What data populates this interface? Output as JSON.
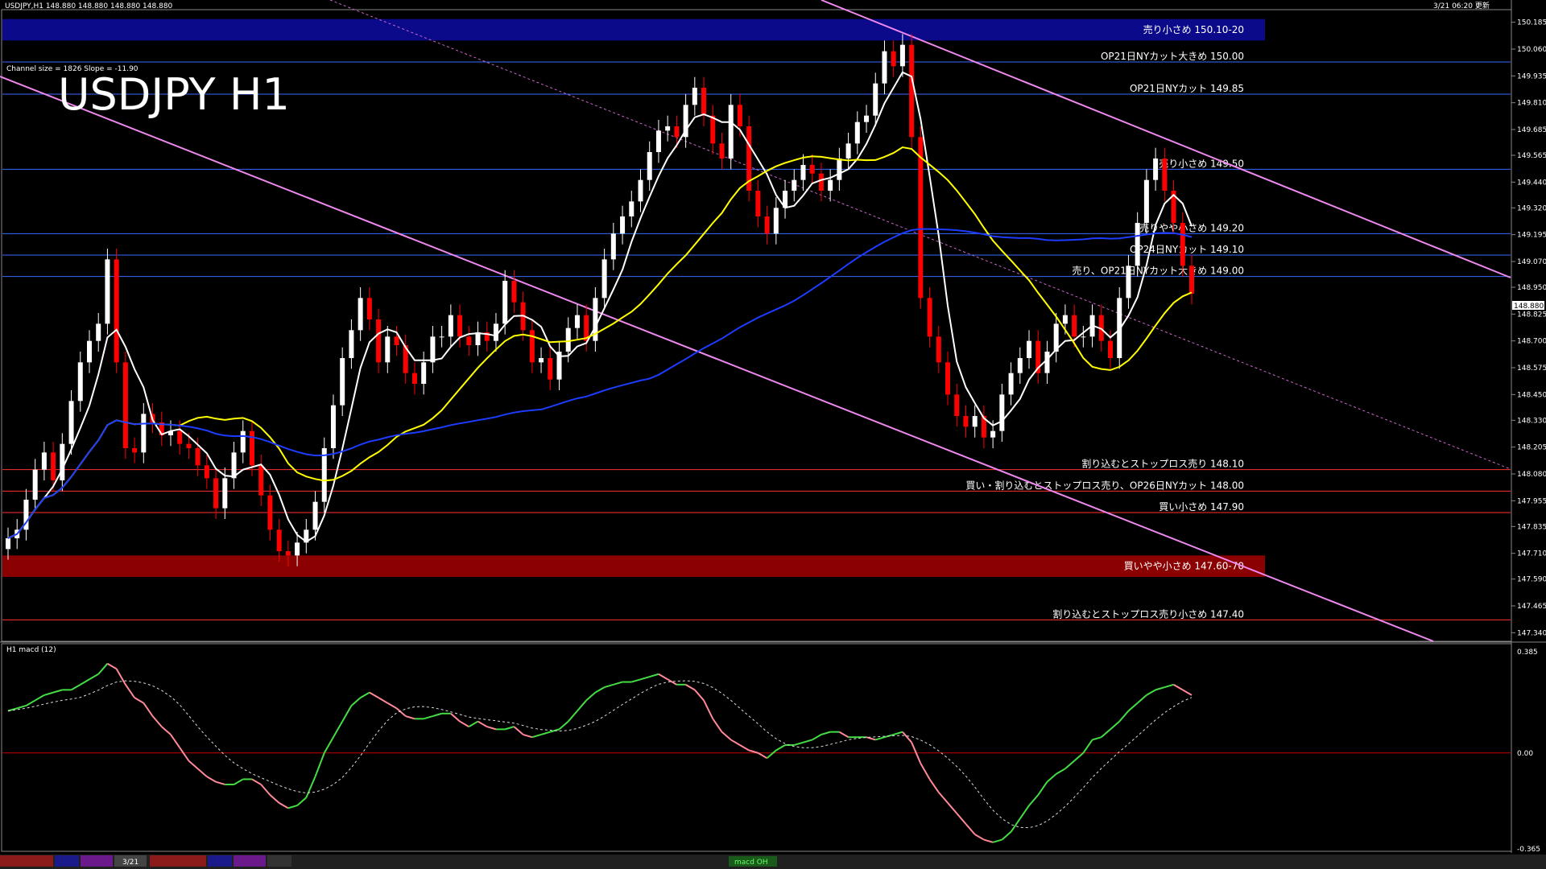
{
  "header": {
    "left": "USDJPY,H1  148.880 148.880 148.880 148.880",
    "right": "3/21 06:20 更新"
  },
  "watermark": "USDJPY H1",
  "channel_info": "Channel size = 1826 Slope = -11.90",
  "subwindow_label": "H1  macd (12)",
  "colors": {
    "bg": "#000000",
    "bull": "#ffffff",
    "bear": "#ff0000",
    "blue_zone": "#0a0a8a",
    "red_zone": "#8b0000",
    "ma_white": "#ffffff",
    "ma_yellow": "#ffff00",
    "ma_blue": "#1e3cff",
    "macd_up": "#44dd44",
    "macd_down": "#ff8899",
    "channel": "#ee88ee"
  },
  "chart_data": {
    "type": "candlestick",
    "symbol": "USDJPY",
    "timeframe": "H1",
    "ylim": [
      147.3,
      150.24
    ],
    "y_ticks": [
      "150.185",
      "150.060",
      "149.935",
      "149.810",
      "149.685",
      "149.565",
      "149.440",
      "149.320",
      "149.195",
      "149.070",
      "148.950",
      "148.825",
      "148.700",
      "148.575",
      "148.450",
      "148.330",
      "148.205",
      "148.080",
      "147.955",
      "147.835",
      "147.710",
      "147.590",
      "147.465",
      "147.340"
    ],
    "current_price": "148.880",
    "zones": [
      {
        "label": "売り小さめ 150.10-20",
        "from": 150.1,
        "to": 150.2,
        "color": "#0a0a8a"
      },
      {
        "label": "買いやや小さめ 147.60-70",
        "from": 147.6,
        "to": 147.7,
        "color": "#8b0000"
      }
    ],
    "levels": [
      {
        "price": 150.0,
        "label": "OP21日NYカット大きめ 150.00"
      },
      {
        "price": 149.85,
        "label": "OP21日NYカット 149.85"
      },
      {
        "price": 149.5,
        "label": "売り小さめ 149.50"
      },
      {
        "price": 149.2,
        "label": "売りやや小さめ 149.20"
      },
      {
        "price": 149.1,
        "label": "OP24日NYカット 149.10"
      },
      {
        "price": 149.0,
        "label": "売り、OP21日NYカット大きめ 149.00"
      },
      {
        "price": 148.1,
        "label": "割り込むとストップロス売り 148.10"
      },
      {
        "price": 148.0,
        "label": "買い・割り込むとストップロス売り、OP26日NYカット 148.00"
      },
      {
        "price": 147.9,
        "label": "買い小さめ 147.90"
      },
      {
        "price": 147.4,
        "label": "割り込むとストップロス売り小さめ 147.40"
      }
    ],
    "close": [
      147.78,
      147.82,
      147.96,
      148.1,
      148.18,
      148.05,
      148.22,
      148.42,
      148.6,
      148.7,
      148.78,
      149.08,
      148.6,
      148.2,
      148.18,
      148.36,
      148.32,
      148.26,
      148.28,
      148.22,
      148.2,
      148.12,
      148.06,
      147.92,
      148.06,
      148.18,
      148.28,
      148.12,
      147.98,
      147.82,
      147.72,
      147.7,
      147.76,
      147.82,
      147.95,
      148.2,
      148.4,
      148.62,
      148.75,
      148.9,
      148.8,
      148.6,
      148.72,
      148.68,
      148.55,
      148.5,
      148.6,
      148.72,
      148.72,
      148.82,
      148.72,
      148.68,
      148.74,
      148.7,
      148.78,
      148.98,
      148.88,
      148.75,
      148.6,
      148.62,
      148.52,
      148.65,
      148.76,
      148.82,
      148.7,
      148.9,
      149.08,
      149.2,
      149.28,
      149.35,
      149.45,
      149.58,
      149.68,
      149.7,
      149.65,
      149.8,
      149.88,
      149.75,
      149.62,
      149.55,
      149.8,
      149.7,
      149.4,
      149.28,
      149.2,
      149.32,
      149.4,
      149.45,
      149.52,
      149.48,
      149.4,
      149.45,
      149.55,
      149.62,
      149.72,
      149.75,
      149.9,
      150.05,
      149.98,
      150.08,
      149.65,
      148.9,
      148.72,
      148.6,
      148.45,
      148.35,
      148.3,
      148.35,
      148.25,
      148.28,
      148.45,
      148.55,
      148.62,
      148.7,
      148.55,
      148.65,
      148.78,
      148.82,
      148.72,
      148.72,
      148.82,
      148.7,
      148.62,
      148.9,
      149.05,
      149.25,
      149.45,
      149.55,
      149.4,
      149.25,
      149.05,
      148.92
    ],
    "macd": [
      0.16,
      0.17,
      0.18,
      0.2,
      0.22,
      0.23,
      0.24,
      0.24,
      0.26,
      0.28,
      0.3,
      0.34,
      0.32,
      0.26,
      0.21,
      0.19,
      0.14,
      0.1,
      0.07,
      0.02,
      -0.03,
      -0.06,
      -0.09,
      -0.11,
      -0.12,
      -0.12,
      -0.1,
      -0.1,
      -0.12,
      -0.16,
      -0.19,
      -0.21,
      -0.2,
      -0.17,
      -0.09,
      0.0,
      0.06,
      0.12,
      0.18,
      0.21,
      0.23,
      0.21,
      0.19,
      0.17,
      0.14,
      0.13,
      0.13,
      0.14,
      0.15,
      0.15,
      0.12,
      0.1,
      0.12,
      0.1,
      0.09,
      0.09,
      0.1,
      0.07,
      0.06,
      0.07,
      0.08,
      0.09,
      0.12,
      0.16,
      0.2,
      0.23,
      0.25,
      0.26,
      0.27,
      0.27,
      0.28,
      0.29,
      0.3,
      0.28,
      0.26,
      0.26,
      0.24,
      0.2,
      0.13,
      0.08,
      0.05,
      0.03,
      0.01,
      0.0,
      -0.02,
      0.01,
      0.03,
      0.03,
      0.04,
      0.05,
      0.07,
      0.08,
      0.08,
      0.06,
      0.06,
      0.06,
      0.05,
      0.06,
      0.07,
      0.08,
      0.04,
      -0.04,
      -0.1,
      -0.15,
      -0.19,
      -0.23,
      -0.27,
      -0.31,
      -0.33,
      -0.34,
      -0.33,
      -0.3,
      -0.25,
      -0.2,
      -0.16,
      -0.11,
      -0.08,
      -0.06,
      -0.03,
      0.0,
      0.05,
      0.06,
      0.09,
      0.12,
      0.16,
      0.19,
      0.22,
      0.24,
      0.25,
      0.26,
      0.24,
      0.22
    ],
    "macd_ylim": [
      -0.365,
      0.385
    ],
    "macd_ticks": [
      "0.385",
      "0.00",
      "-0.365"
    ],
    "bottom_tabs": [
      "3/21",
      "macd OH"
    ]
  }
}
